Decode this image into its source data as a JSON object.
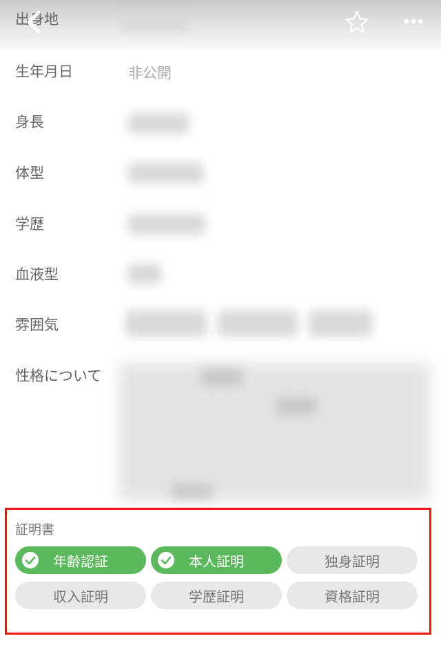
{
  "header": {
    "first_row_label": "出身地",
    "icons": [
      "back-icon",
      "star-icon",
      "more-icon"
    ]
  },
  "profile": {
    "rows": [
      {
        "label": "生年月日",
        "value": "非公開"
      },
      {
        "label": "身長"
      },
      {
        "label": "体型"
      },
      {
        "label": "学歴"
      },
      {
        "label": "血液型"
      },
      {
        "label": "雰囲気"
      },
      {
        "label": "性格について"
      }
    ]
  },
  "certificates": {
    "title": "証明書",
    "items": [
      {
        "label": "年齢認証",
        "verified": true
      },
      {
        "label": "本人証明",
        "verified": true
      },
      {
        "label": "独身証明",
        "verified": false
      },
      {
        "label": "収入証明",
        "verified": false
      },
      {
        "label": "学歴証明",
        "verified": false
      },
      {
        "label": "資格証明",
        "verified": false
      }
    ]
  },
  "colors": {
    "verified_chip": "#5cb85c",
    "unverified_chip": "#e8e8e8",
    "highlight_border": "#ee1111"
  }
}
